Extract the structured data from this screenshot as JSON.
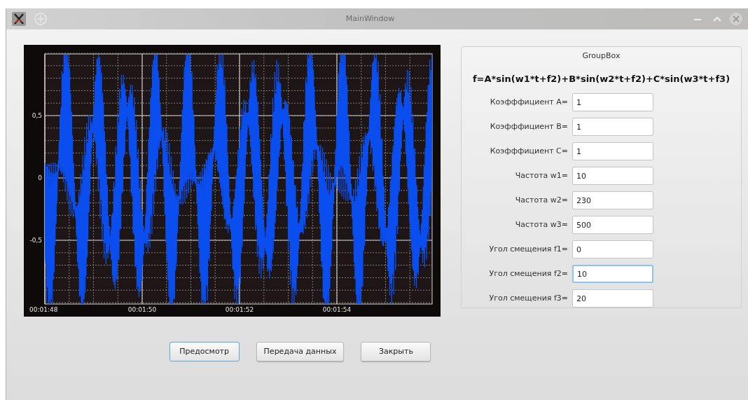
{
  "window": {
    "title": "MainWindow"
  },
  "plot": {
    "y_labels": [
      "0,5",
      "0",
      "-0,5"
    ],
    "x_labels": [
      "00:01:48",
      "00:01:50",
      "00:01:52",
      "00:01:54"
    ]
  },
  "group_box": {
    "title": "GroupBox",
    "formula": "f=A*sin(w1*t+f2)+B*sin(w2*t+f2)+C*sin(w3*t+f3)",
    "fields": [
      {
        "label": "Коэфффициент A=",
        "value": "1",
        "focused": false
      },
      {
        "label": "Коэфффициент B=",
        "value": "1",
        "focused": false
      },
      {
        "label": "Коэфффициент C=",
        "value": "1",
        "focused": false
      },
      {
        "label": "Частота w1=",
        "value": "10",
        "focused": false
      },
      {
        "label": "Частота w2=",
        "value": "230",
        "focused": false
      },
      {
        "label": "Частота w3=",
        "value": "500",
        "focused": false
      },
      {
        "label": "Угол смещения f1=",
        "value": "0",
        "focused": false
      },
      {
        "label": "Угол смещения f2=",
        "value": "10",
        "focused": true
      },
      {
        "label": "Угол смещения f3=",
        "value": "20",
        "focused": false
      }
    ]
  },
  "buttons": [
    {
      "label": "Предосмотр",
      "focused": true
    },
    {
      "label": "Передача данных",
      "focused": false
    },
    {
      "label": "Закрыть",
      "focused": false
    }
  ]
}
